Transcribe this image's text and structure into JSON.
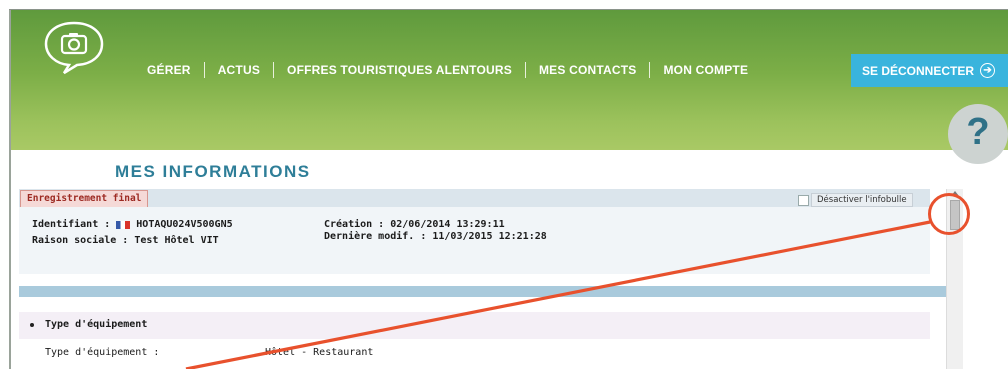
{
  "nav": {
    "items": [
      "GÉRER",
      "ACTUS",
      "OFFRES TOURISTIQUES ALENTOURS",
      "MES CONTACTS",
      "MON COMPTE"
    ],
    "logout_label": "SE DÉCONNECTER",
    "logout_icon": "arrow-right-circle-icon"
  },
  "help": {
    "label": "?"
  },
  "page": {
    "title": "MES INFORMATIONS"
  },
  "panel": {
    "status_tag": "Enregistrement final",
    "tooltip_toggle": "Désactiver l'infobulle",
    "identifiant_label": "Identifiant :",
    "identifiant_value": "HOTAQU024V500GN5",
    "raison_sociale": "Raison sociale : Test Hôtel VIT",
    "creation": "Création : 02/06/2014 13:29:11",
    "modif": "Dernière modif. : 11/03/2015 12:21:28"
  },
  "section": {
    "title": "Type d'équipement",
    "field_label": "Type d'équipement :",
    "field_value": "Hôtel - Restaurant"
  },
  "colors": {
    "banner": "#7cae47",
    "accent_blue": "#39b4dd",
    "title_blue": "#2e7e98",
    "annotation_red": "#e8512d"
  }
}
